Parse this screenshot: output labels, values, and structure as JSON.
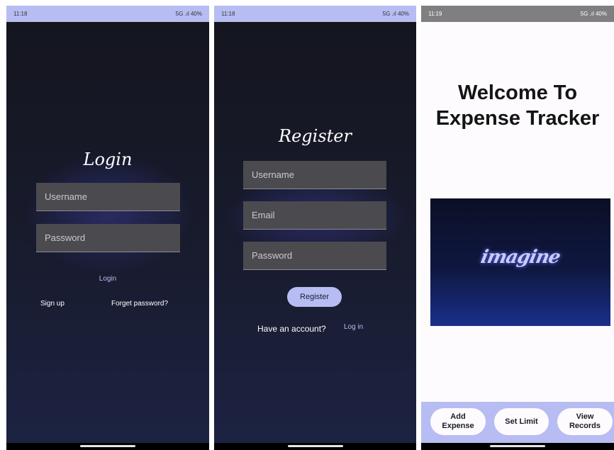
{
  "colors": {
    "status_bar": "#b7bdf2",
    "dark_bg": "#181b2c",
    "field_bg": "#4a4a4f",
    "accent_button": "#b7bdf2",
    "link": "#b7bdf2"
  },
  "login": {
    "status_time": "11:18",
    "status_right": "5G .ıl 40%",
    "title": "Login",
    "username_placeholder": "Username",
    "password_placeholder": "Password",
    "login_label": "Login",
    "signup_label": "Sign up",
    "forget_label": "Forget password?"
  },
  "register": {
    "status_time": "11:18",
    "status_right": "5G .ıl 40%",
    "title": "Register",
    "username_placeholder": "Username",
    "email_placeholder": "Email",
    "password_placeholder": "Password",
    "register_label": "Register",
    "have_account_text": "Have an account?",
    "login_link": "Log in"
  },
  "home": {
    "status_time": "11:19",
    "status_right": "5G .ıl 40%",
    "welcome_line1": "Welcome To",
    "welcome_line2": "Expense Tracker",
    "hero_text": "imagine",
    "add_expense_line1": "Add",
    "add_expense_line2": "Expense",
    "set_limit": "Set Limit",
    "view_records_line1": "View",
    "view_records_line2": "Records"
  }
}
